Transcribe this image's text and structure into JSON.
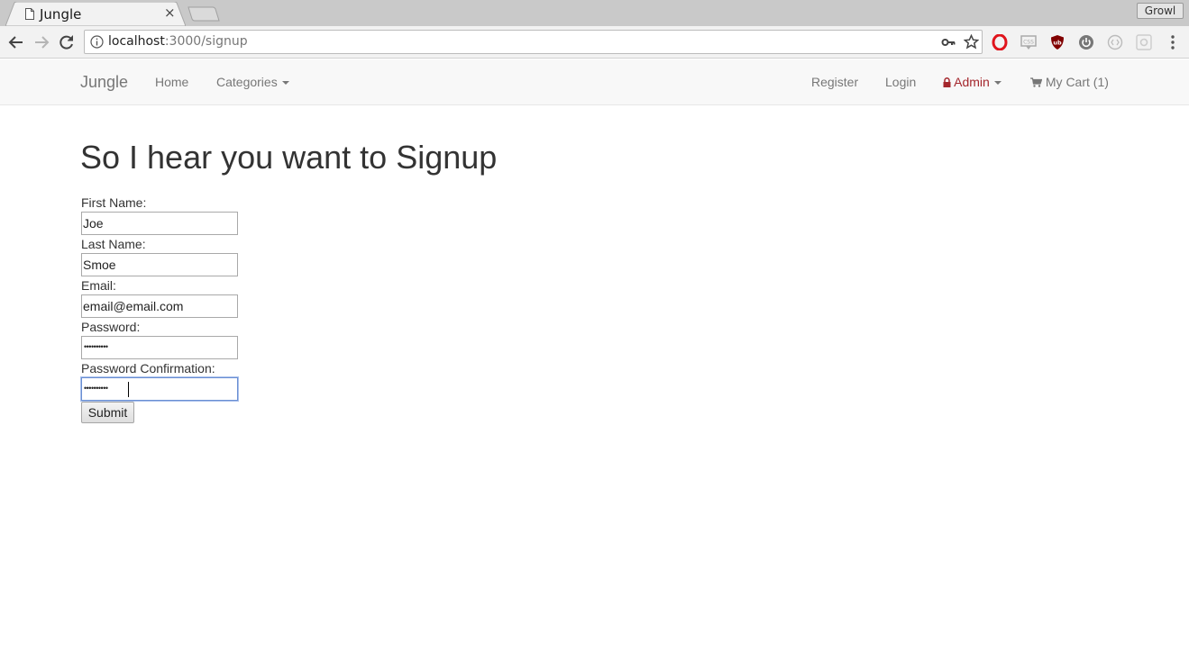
{
  "browser": {
    "tab_title": "Jungle",
    "tab_close": "×",
    "growl_label": "Growl",
    "url_host": "localhost",
    "url_rest": ":3000/signup"
  },
  "navbar": {
    "brand": "Jungle",
    "home": "Home",
    "categories": "Categories",
    "register": "Register",
    "login": "Login",
    "admin": "Admin",
    "cart": "My Cart (1)"
  },
  "form": {
    "heading": "So I hear you want to Signup",
    "first_name_label": "First Name:",
    "first_name_value": "Joe",
    "last_name_label": "Last Name:",
    "last_name_value": "Smoe",
    "email_label": "Email:",
    "email_value": "email@email.com",
    "password_label": "Password:",
    "password_mask": "••••••••••",
    "password_confirmation_label": "Password Confirmation:",
    "password_confirmation_mask": "••••••••••",
    "submit_label": "Submit"
  },
  "colors": {
    "admin_link": "#a4262c",
    "navbar_bg": "#f8f8f8",
    "focus_border": "#6a8fd3"
  }
}
